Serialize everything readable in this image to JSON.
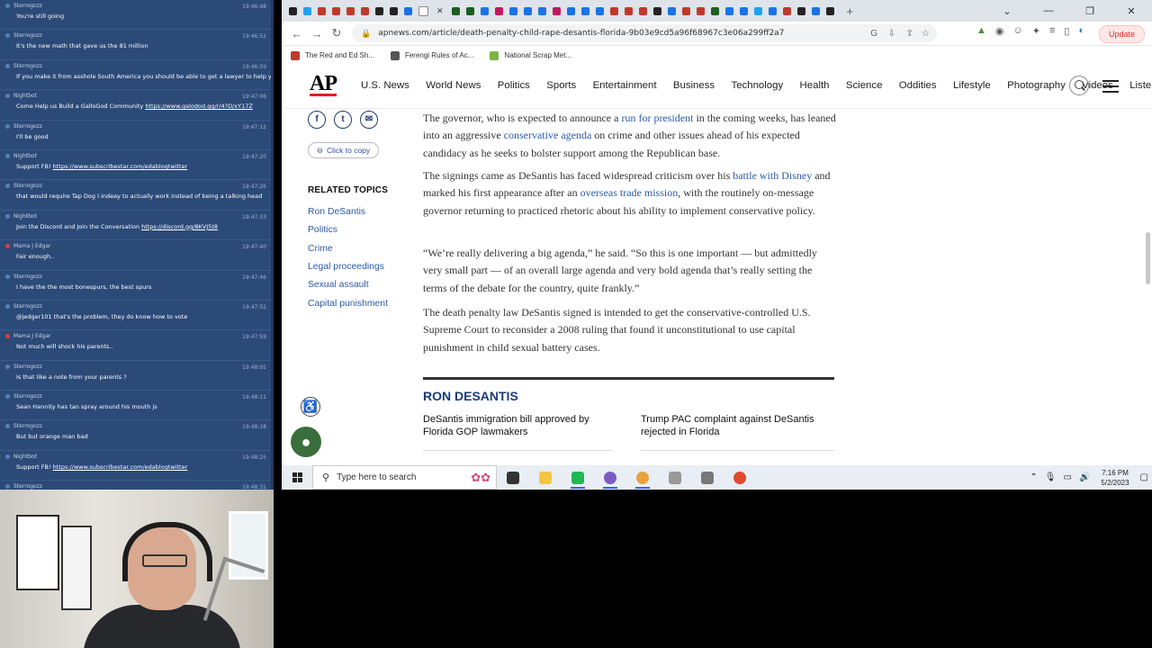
{
  "chat": {
    "messages": [
      {
        "user": "Sterrogozz",
        "time": "19:46:48",
        "text": "You're still going",
        "red": false
      },
      {
        "user": "Sterrogozz",
        "time": "19:46:52",
        "text": "It's the new math that gave us the 81 million",
        "red": false
      },
      {
        "user": "Sterrogozz",
        "time": "19:46:59",
        "text": "If you make it from asshole South America you should be able to get a lawyer to help you",
        "red": false
      },
      {
        "user": "Nightbot",
        "time": "19:47:06",
        "text": "Come Help us Build a GalloGod Community ",
        "link": "https://www.galodod.gg/r/4?D/xY17Z",
        "red": false
      },
      {
        "user": "Sterrogozz",
        "time": "19:47:12",
        "text": "I'll be good",
        "red": false
      },
      {
        "user": "Nightbot",
        "time": "19:47:20",
        "text": "Support FB! ",
        "link": "https://www.subscribestar.com/edablogtwitter",
        "red": false
      },
      {
        "user": "Sterrogozz",
        "time": "19:47:26",
        "text": "that would require Tap Dog I indeay to actually work instead of being a talking head",
        "red": false
      },
      {
        "user": "Nightbot",
        "time": "19:47:33",
        "text": "Join the Discord and Join the Conversation ",
        "link": "https://discord.gg/8KVJ5t8",
        "red": false
      },
      {
        "user": "Mama J Edgar",
        "time": "19:47:40",
        "text": "Fair enough..",
        "red": true
      },
      {
        "user": "Sterrogozz",
        "time": "19:47:46",
        "text": "I have the the most bonespurs, the best spurs",
        "red": false
      },
      {
        "user": "Sterrogozz",
        "time": "19:47:52",
        "text": "@jedger101 that's the problem, they do know how to vote",
        "red": false
      },
      {
        "user": "Mama J Edgar",
        "time": "19:47:59",
        "text": "Not much will shock his parents..",
        "red": true
      },
      {
        "user": "Sterrogozz",
        "time": "19:48:05",
        "text": "Is that like a note from your parents ?",
        "red": false
      },
      {
        "user": "Sterrogozz",
        "time": "19:48:11",
        "text": "Sean Hannity has tan spray around his mouth js",
        "red": false
      },
      {
        "user": "Sterrogozz",
        "time": "19:48:18",
        "text": "But but orange man bad",
        "red": false
      },
      {
        "user": "Nightbot",
        "time": "19:48:25",
        "text": "Support FB! ",
        "link": "https://www.subscribestar.com/edablogtwitter",
        "red": false
      },
      {
        "user": "Sterrogozz",
        "time": "19:48:31",
        "text": "",
        "red": false
      }
    ]
  },
  "browser": {
    "url": "apnews.com/article/death-penalty-child-rape-desantis-florida-9b03e9cd5a96f68967c3e06a299ff2a7",
    "update_label": "Update",
    "bookmarks": [
      {
        "label": "The Red and Ed Sh...",
        "color": "#c0392b"
      },
      {
        "label": "Ferengi Rules of Ac...",
        "color": "#555555"
      },
      {
        "label": "National Scrap Met...",
        "color": "#7cb342"
      }
    ],
    "tab_colors": [
      "#222",
      "#1da1f2",
      "#c0392b",
      "#c0392b",
      "#c0392b",
      "#c0392b",
      "#222",
      "#222",
      "#1a73e8",
      "#fff",
      "#1b5e20",
      "#1b5e20",
      "#1a73e8",
      "#c2185b",
      "#1a73e8",
      "#1a73e8",
      "#1a73e8",
      "#c2185b",
      "#1a73e8",
      "#1a73e8",
      "#1a73e8",
      "#c0392b",
      "#c0392b",
      "#c0392b",
      "#222",
      "#1a73e8",
      "#c0392b",
      "#c0392b",
      "#1b5e20",
      "#1a73e8",
      "#1a73e8",
      "#1da1f2",
      "#1a73e8",
      "#c0392b",
      "#222",
      "#1a73e8",
      "#222"
    ]
  },
  "site": {
    "logo": "AP",
    "nav": [
      "U.S. News",
      "World News",
      "Politics",
      "Sports",
      "Entertainment",
      "Business",
      "Technology",
      "Health",
      "Science",
      "Oddities",
      "Lifestyle",
      "Photography",
      "Videos",
      "Listen"
    ],
    "copy_label": "Click to copy",
    "related_title": "RELATED TOPICS",
    "related": [
      "Ron DeSantis",
      "Politics",
      "Crime",
      "Legal proceedings",
      "Sexual assault",
      "Capital punishment"
    ],
    "paragraphs": [
      {
        "parts": [
          {
            "t": "The governor, who is expected to announce a "
          },
          {
            "t": "run for president",
            "link": true
          },
          {
            "t": " in the coming weeks, has leaned into an aggressive "
          },
          {
            "t": "conservative agenda",
            "link": true
          },
          {
            "t": " on crime and other issues ahead of his expected candidacy as he seeks to bolster support among the Republican base."
          }
        ]
      },
      {
        "parts": [
          {
            "t": "The signings came as DeSantis has faced widespread criticism over his "
          },
          {
            "t": "battle with Disney",
            "link": true
          },
          {
            "t": " and marked his first appearance after an "
          },
          {
            "t": "overseas trade mission",
            "link": true
          },
          {
            "t": ", with the routinely on-message governor returning to practiced rhetoric about his ability to implement conservative policy."
          }
        ]
      },
      {
        "parts": [
          {
            "t": "“We’re really delivering a big agenda,” he said. “So this is one important — but admittedly very small part — of an overall large agenda and very bold agenda that’s really setting the terms of the debate for the country, quite frankly.”"
          }
        ]
      },
      {
        "parts": [
          {
            "t": "The death penalty law DeSantis signed is intended to get the conservative-controlled U.S. Supreme Court to reconsider a 2008 ruling that found it unconstitutional to use capital punishment in child sexual battery cases."
          }
        ]
      }
    ],
    "section_title": "RON DESANTIS",
    "stories": [
      "DeSantis immigration bill approved by Florida GOP lawmakers",
      "Trump PAC complaint against DeSantis rejected in Florida"
    ]
  },
  "taskbar": {
    "search_placeholder": "Type here to search",
    "time": "7:16 PM",
    "date": "5/2/2023",
    "apps": [
      {
        "name": "task-view",
        "color": "#333"
      },
      {
        "name": "file-explorer",
        "color": "#f4c542"
      },
      {
        "name": "app-green",
        "color": "#1db954"
      },
      {
        "name": "app-discord",
        "color": "#7a5cc2"
      },
      {
        "name": "chrome",
        "color": "#e8a33d"
      },
      {
        "name": "media-player",
        "color": "#999"
      },
      {
        "name": "app-window",
        "color": "#777"
      },
      {
        "name": "app-red",
        "color": "#e04a2f"
      }
    ]
  }
}
